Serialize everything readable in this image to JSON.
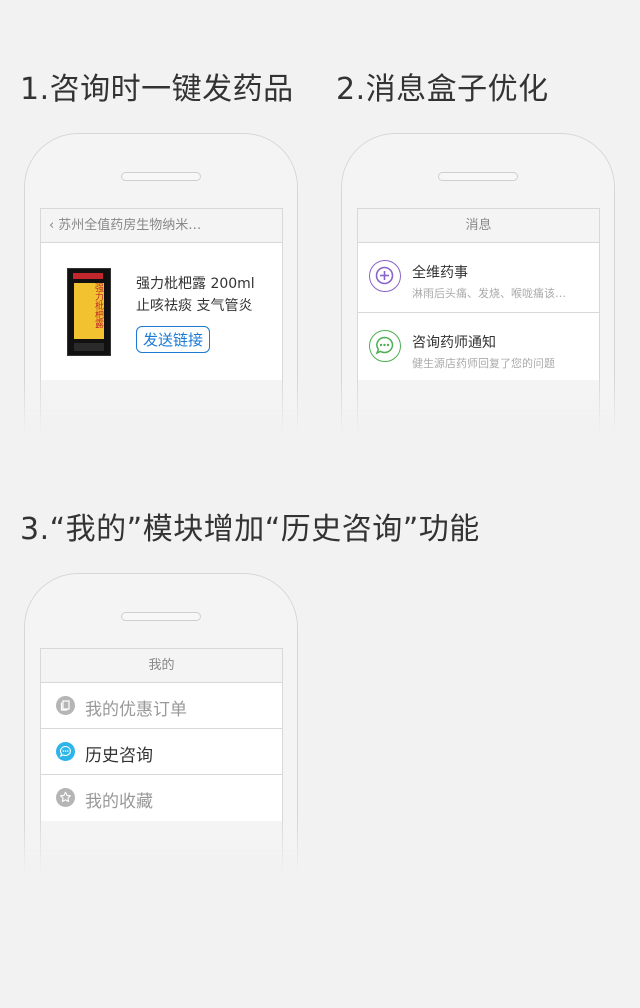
{
  "sections": {
    "s1": {
      "title": "1.咨询时一键发药品"
    },
    "s2": {
      "title": "2.消息盒子优化"
    },
    "s3": {
      "title": "3.“我的”模块增加“历史咨询”功能"
    }
  },
  "phone1": {
    "header": "苏州全值药房生物纳米…",
    "product": {
      "box_text": "强力枇杷露",
      "name": "强力枇杷露 200ml",
      "desc": "止咳祛痰 支气管炎",
      "send_label": "发送链接"
    }
  },
  "phone2": {
    "header": "消息",
    "messages": [
      {
        "title": "全维药事",
        "subtitle": "淋雨后头痛、发烧、喉咙痛该…",
        "icon": "plus-circle-icon",
        "color": "#8a63c9"
      },
      {
        "title": "咨询药师通知",
        "subtitle": "健生源店药师回复了您的问题",
        "icon": "chat-bubble-icon",
        "color": "#4caf50"
      }
    ]
  },
  "phone3": {
    "header": "我的",
    "items": [
      {
        "label": "我的优惠订单",
        "icon": "copy-icon",
        "color": "#b5b5b5",
        "active": false
      },
      {
        "label": "历史咨询",
        "icon": "chat-bubble-icon",
        "color": "#2cb5e8",
        "active": true
      },
      {
        "label": "我的收藏",
        "icon": "star-icon",
        "color": "#b5b5b5",
        "active": false
      }
    ]
  }
}
